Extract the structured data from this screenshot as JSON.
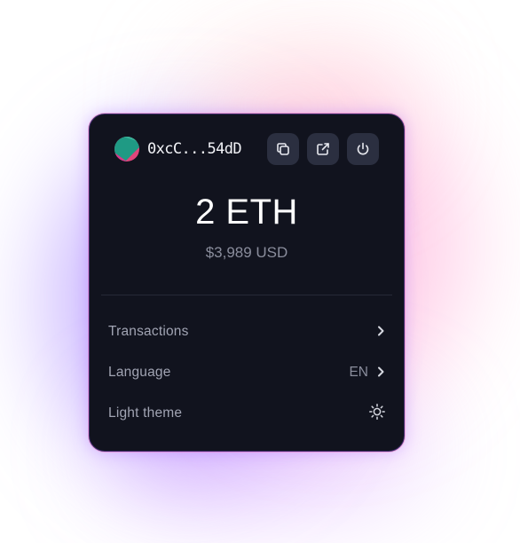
{
  "wallet": {
    "address": "0xcC...54dD"
  },
  "header": {
    "copy_icon": "copy-icon",
    "external_link_icon": "external-link-icon",
    "power_icon": "power-icon"
  },
  "balance": {
    "amount": "2 ETH",
    "fiat": "$3,989 USD"
  },
  "menu": {
    "transactions": {
      "label": "Transactions",
      "icon": "chevron-right-icon"
    },
    "language": {
      "label": "Language",
      "value": "EN",
      "icon": "chevron-right-icon"
    },
    "theme": {
      "label": "Light theme",
      "icon": "sun-icon"
    }
  },
  "colors": {
    "card_background": "#11131e",
    "button_background": "#2b2f40",
    "text_primary": "#ffffff",
    "text_secondary": "#a1a4b3",
    "avatar_pink": "#e0457b",
    "avatar_green": "#1f9a84"
  }
}
